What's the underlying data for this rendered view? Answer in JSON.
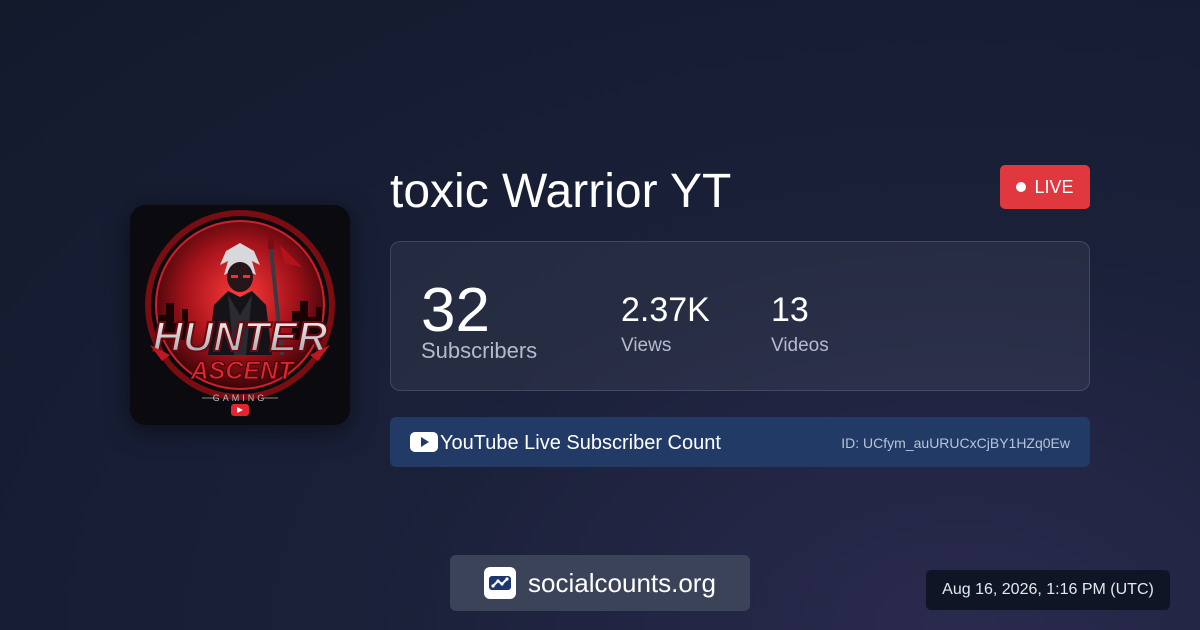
{
  "channel": {
    "name": "toxic Warrior YT",
    "avatar_lettering": [
      "HUNTER",
      "ASCENT",
      "GAMING"
    ],
    "status": "LIVE"
  },
  "stats": {
    "subscribers": {
      "value": "32",
      "label": "Subscribers"
    },
    "views": {
      "value": "2.37K",
      "label": "Views"
    },
    "videos": {
      "value": "13",
      "label": "Videos"
    }
  },
  "info_bar": {
    "icon": "youtube-icon",
    "label": "YouTube Live Subscriber Count",
    "channel_id": "ID: UCfym_auURUCxCjBY1HZq0Ew"
  },
  "brand": {
    "icon": "socialcounts-logo-icon",
    "name": "socialcounts.org"
  },
  "timestamp": "Aug 16, 2026, 1:16 PM (UTC)",
  "colors": {
    "live_badge": "#e0383e",
    "info_bar": "#223a66",
    "brand_button": "#3b4358",
    "youtube": "#ffffff"
  }
}
